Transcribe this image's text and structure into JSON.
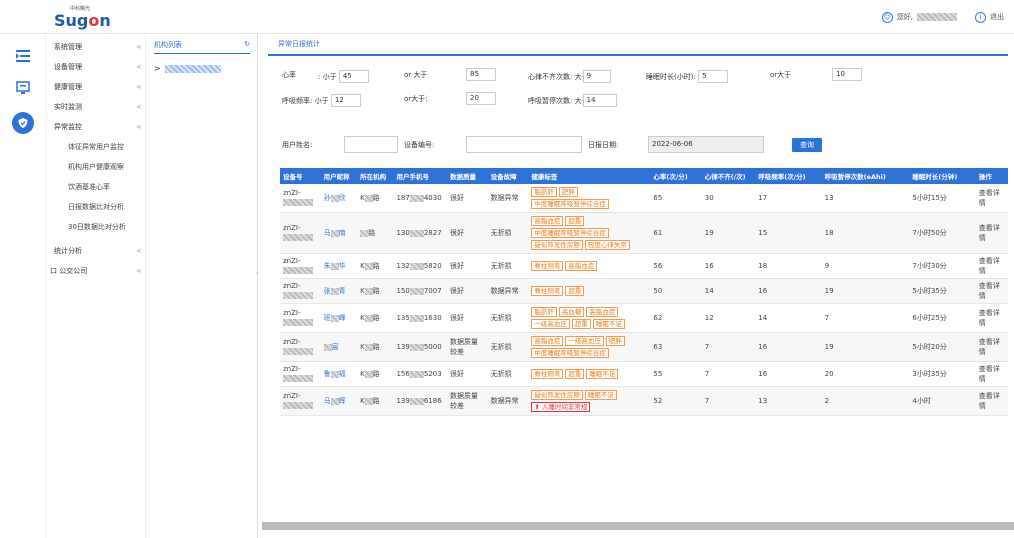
{
  "header": {
    "logo_cn": "中科曙光",
    "logo_en_pre": "Sug",
    "logo_en_mid": "o",
    "logo_en_post": "n",
    "greeting": "您好,",
    "logout": "退出"
  },
  "iconbar": {
    "icons": [
      "menu-toggle-icon",
      "monitor-icon",
      "shield-icon"
    ]
  },
  "menu": {
    "items": [
      {
        "label": "系统管理",
        "chev": "<"
      },
      {
        "label": "设备管理",
        "chev": "<"
      },
      {
        "label": "健康管理",
        "chev": "<"
      },
      {
        "label": "实时监测",
        "chev": "<"
      },
      {
        "label": "异常监控",
        "chev": "<"
      }
    ],
    "subitems": [
      "体征异常用户监控",
      "机构用户健康观察",
      "饮酒基准心率",
      "日报数据比对分析",
      "30日数据比对分析"
    ],
    "bottom": [
      {
        "label": "统计分析",
        "chev": "<"
      },
      {
        "label": "公交公司",
        "chev": "<",
        "prefix": "口"
      }
    ]
  },
  "org": {
    "title": "机构列表",
    "refresh": "↻",
    "expand": ">"
  },
  "tabs": {
    "active": "异常日报统计"
  },
  "filters": {
    "hr_label": "心率",
    "lt_label": ": 小于",
    "hr_lt": "45",
    "or_gt1": "or 大于",
    "hr_gt": "85",
    "irr_label": "心律不齐次数: 大于",
    "irr_val": "9",
    "sleep_label": "睡眠时长(小时):",
    "sleep_lt": "5",
    "or_gt2": "or大于",
    "sleep_gt": "10",
    "rr_label": "呼吸频率: 小于",
    "rr_lt": "12",
    "or_gt3": "or大于:",
    "rr_gt": "20",
    "apnea_label": "呼吸暂停次数: 大于",
    "apnea_val": "14",
    "name_label": "用户姓名:",
    "device_label": "设备编号:",
    "date_label": "日报日期:",
    "date_val": "2022-06-06",
    "query": "查询"
  },
  "table": {
    "headers": [
      "设备号",
      "用户昵称",
      "所在机构",
      "用户手机号",
      "数据质量",
      "设备故障",
      "健康标签",
      "心率(次/分)",
      "心律不齐(/次)",
      "呼吸频率(次/分)",
      "呼吸暂停次数(eAhi)",
      "睡眠时长(分钟)",
      "操作"
    ],
    "rows": [
      {
        "dev": "znZI-",
        "name_a": "孙",
        "name_b": "欣",
        "org_a": "K",
        "org_b": "路",
        "phone_a": "187",
        "phone_b": "4030",
        "quality": "很好",
        "fault": "数据异常",
        "tags": [
          "脂肪肝",
          "肥胖",
          "中度睡眠呼吸暂停综合症"
        ],
        "hr": "65",
        "irr": "30",
        "rr": "17",
        "apnea": "13",
        "sleep": "5小时15分",
        "op": "查看详情",
        "irr_red": true,
        "apnea_red": false,
        "sleep_red": false
      },
      {
        "dev": "znZI-",
        "name_a": "马",
        "name_b": "南",
        "org_a": "",
        "org_b": "路",
        "phone_a": "130",
        "phone_b": "2827",
        "quality": "很好",
        "fault": "无折损",
        "tags": [
          "高脂血症",
          "超重",
          "中度睡眠呼吸暂停综合症",
          "疑似阵发性房颤",
          "轻度心律失常"
        ],
        "hr": "61",
        "irr": "19",
        "rr": "15",
        "apnea": "18",
        "sleep": "7小时50分",
        "op": "查看详情",
        "irr_red": true,
        "apnea_red": true,
        "sleep_red": false
      },
      {
        "dev": "znZI-",
        "name_a": "朱",
        "name_b": "华",
        "org_a": "K",
        "org_b": "路",
        "phone_a": "132",
        "phone_b": "5820",
        "quality": "很好",
        "fault": "无折损",
        "tags": [
          "脊柱侧弯",
          "高脂血症"
        ],
        "hr": "56",
        "irr": "16",
        "rr": "18",
        "apnea": "9",
        "sleep": "7小时30分",
        "op": "查看详情",
        "irr_red": true,
        "apnea_red": false,
        "sleep_red": false
      },
      {
        "dev": "znZI-",
        "name_a": "张",
        "name_b": "青",
        "org_a": "K",
        "org_b": "路",
        "phone_a": "150",
        "phone_b": "7007",
        "quality": "很好",
        "fault": "数据异常",
        "tags": [
          "脊柱侧弯",
          "超重"
        ],
        "hr": "50",
        "irr": "14",
        "rr": "16",
        "apnea": "19",
        "sleep": "5小时35分",
        "op": "查看详情",
        "irr_red": true,
        "apnea_red": true,
        "sleep_red": false
      },
      {
        "dev": "znZI-",
        "name_a": "班",
        "name_b": "峰",
        "org_a": "K",
        "org_b": "路",
        "phone_a": "135",
        "phone_b": "1630",
        "quality": "很好",
        "fault": "无折损",
        "tags": [
          "脂肪肝",
          "高血糖",
          "高脂血症",
          "一级高血压",
          "超重",
          "睡眠不足"
        ],
        "hr": "62",
        "irr": "12",
        "rr": "14",
        "apnea": "7",
        "sleep": "6小时25分",
        "op": "查看详情",
        "irr_red": true,
        "apnea_red": false,
        "sleep_red": false
      },
      {
        "dev": "znZI-",
        "name_a": "",
        "name_b": "宸",
        "org_a": "K",
        "org_b": "路",
        "phone_a": "139",
        "phone_b": "5000",
        "quality": "数据质量较差",
        "fault": "无折损",
        "tags": [
          "高脂血症",
          "一级高血压",
          "肥胖",
          "中度睡眠呼吸暂停综合症"
        ],
        "hr": "63",
        "irr": "7",
        "rr": "16",
        "apnea": "19",
        "sleep": "5小时20分",
        "op": "查看详情",
        "irr_red": false,
        "apnea_red": true,
        "sleep_red": false
      },
      {
        "dev": "znZI-",
        "name_a": "鲁",
        "name_b": "福",
        "org_a": "K",
        "org_b": "路",
        "phone_a": "156",
        "phone_b": "5203",
        "quality": "很好",
        "fault": "无折损",
        "tags": [
          "脊柱侧弯",
          "超重",
          "睡眠不足"
        ],
        "hr": "55",
        "irr": "7",
        "rr": "16",
        "apnea": "20",
        "sleep": "3小时35分",
        "op": "查看详情",
        "irr_red": false,
        "apnea_red": true,
        "sleep_red": true
      },
      {
        "dev": "znZI-",
        "name_a": "马",
        "name_b": "辉",
        "org_a": "K",
        "org_b": "路",
        "phone_a": "139",
        "phone_b": "6186",
        "quality": "数据质量较差",
        "fault": "数据异常",
        "tags": [
          "疑似阵发性房颤",
          "睡眠不足",
          "入睡时间非常规"
        ],
        "hr": "52",
        "irr": "7",
        "rr": "13",
        "apnea": "2",
        "sleep": "4小时",
        "op": "查看详情",
        "irr_red": false,
        "apnea_red": false,
        "sleep_red": true
      }
    ]
  },
  "colors": {
    "primary": "#2d72d9",
    "tag": "#f27b1a",
    "alert": "#e33333"
  }
}
